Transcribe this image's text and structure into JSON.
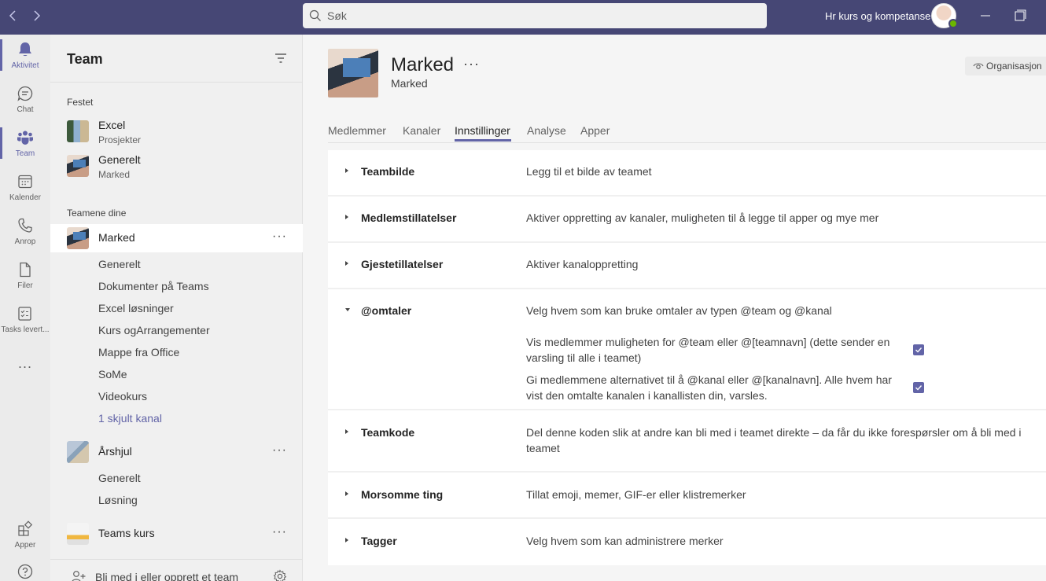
{
  "topbar": {
    "search_placeholder": "Søk",
    "org_name": "Hr kurs og kompetanse"
  },
  "rail": {
    "items": [
      {
        "label": "Aktivitet",
        "icon": "bell-icon"
      },
      {
        "label": "Chat",
        "icon": "chat-icon"
      },
      {
        "label": "Team",
        "icon": "teams-icon"
      },
      {
        "label": "Kalender",
        "icon": "calendar-icon"
      },
      {
        "label": "Anrop",
        "icon": "phone-icon"
      },
      {
        "label": "Filer",
        "icon": "file-icon"
      },
      {
        "label": "Tasks levert...",
        "icon": "tasks-icon"
      },
      {
        "label": "Apper",
        "icon": "apps-icon"
      }
    ],
    "more": "..."
  },
  "panel": {
    "title": "Team",
    "pinned_label": "Festet",
    "pinned": [
      {
        "name": "Excel",
        "sub": "Prosjekter"
      },
      {
        "name": "Generelt",
        "sub": "Marked"
      }
    ],
    "yours_label": "Teamene dine",
    "teams": [
      {
        "name": "Marked",
        "channels": [
          "Generelt",
          "Dokumenter på Teams",
          "Excel løsninger",
          "Kurs ogArrangementer",
          "Mappe fra Office",
          "SoMe",
          "Videokurs"
        ],
        "hidden": "1 skjult kanal"
      },
      {
        "name": "Årshjul",
        "channels": [
          "Generelt",
          "Løsning"
        ]
      },
      {
        "name": "Teams kurs",
        "channels": []
      }
    ],
    "join_label": "Bli med i eller opprett et team"
  },
  "main": {
    "team_name": "Marked",
    "team_sub": "Marked",
    "org_badge": "Organisasjon",
    "tabs": [
      "Medlemmer",
      "Kanaler",
      "Innstillinger",
      "Analyse",
      "Apper"
    ],
    "active_tab": "Innstillinger",
    "settings": [
      {
        "title": "Teambilde",
        "desc": "Legg til et bilde av teamet",
        "expanded": false
      },
      {
        "title": "Medlemstillatelser",
        "desc": "Aktiver oppretting av kanaler, muligheten til å legge til apper og mye mer",
        "expanded": false
      },
      {
        "title": "Gjestetillatelser",
        "desc": "Aktiver kanaloppretting",
        "expanded": false
      },
      {
        "title": "@omtaler",
        "desc": "Velg hvem som kan bruke omtaler av typen @team og @kanal",
        "expanded": true,
        "options": [
          {
            "text": "Vis medlemmer muligheten for @team eller @[teamnavn] (dette sender en varsling til alle i teamet)",
            "checked": true
          },
          {
            "text": "Gi medlemmene alternativet til å @kanal eller @[kanalnavn]. Alle hvem har vist den omtalte kanalen i kanallisten din, varsles.",
            "checked": true
          }
        ]
      },
      {
        "title": "Teamkode",
        "desc": "Del denne koden slik at andre kan bli med i teamet direkte – da får du ikke forespørsler om å bli med i teamet",
        "expanded": false
      },
      {
        "title": "Morsomme ting",
        "desc": "Tillat emoji, memer, GIF-er eller klistremerker",
        "expanded": false
      },
      {
        "title": "Tagger",
        "desc": "Velg hvem som kan administrere merker",
        "expanded": false
      }
    ]
  },
  "colors": {
    "brand": "#464775",
    "accent": "#6264a7"
  }
}
